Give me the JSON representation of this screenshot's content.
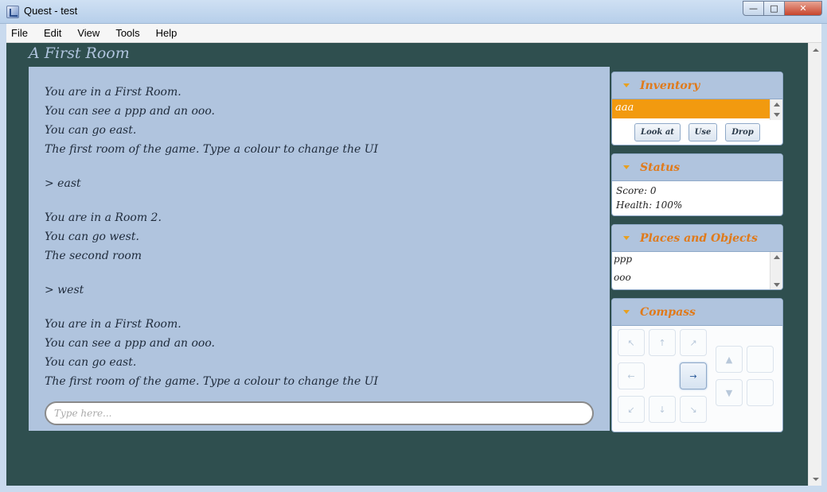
{
  "window": {
    "title": "Quest - test",
    "controls": {
      "minimize": "—",
      "maximize": "□",
      "close": "✕"
    }
  },
  "menu": [
    "File",
    "Edit",
    "View",
    "Tools",
    "Help"
  ],
  "room_title": "A First Room",
  "output": {
    "para1": [
      "You are in a First Room.",
      "You can see a ppp and an ooo.",
      "You can go east.",
      "The first room of the game. Type a colour to change the UI"
    ],
    "cmd1": "> east",
    "para2": [
      "You are in a Room 2.",
      "You can go west.",
      "The second room"
    ],
    "cmd2": "> west",
    "para3": [
      "You are in a First Room.",
      "You can see a ppp and an ooo.",
      "You can go east.",
      "The first room of the game. Type a colour to change the UI"
    ]
  },
  "input": {
    "placeholder": "Type here..."
  },
  "inventory": {
    "title": "Inventory",
    "items": [
      "aaa"
    ],
    "buttons": {
      "look": "Look at",
      "use": "Use",
      "drop": "Drop"
    }
  },
  "status": {
    "title": "Status",
    "score": "Score: 0",
    "health": "Health: 100%"
  },
  "places": {
    "title": "Places and Objects",
    "items": [
      "ppp",
      "ooo"
    ]
  },
  "compass": {
    "title": "Compass",
    "nw": "↖",
    "n": "↑",
    "ne": "↗",
    "w": "←",
    "e": "→",
    "sw": "↙",
    "s": "↓",
    "se": "↘",
    "up": "▲",
    "down": "▼",
    "active": "east"
  },
  "colors": {
    "background": "#2f4f4f",
    "panel": "#b0c4de",
    "accent": "#f29a0f",
    "pane_title": "#e07a1a"
  }
}
